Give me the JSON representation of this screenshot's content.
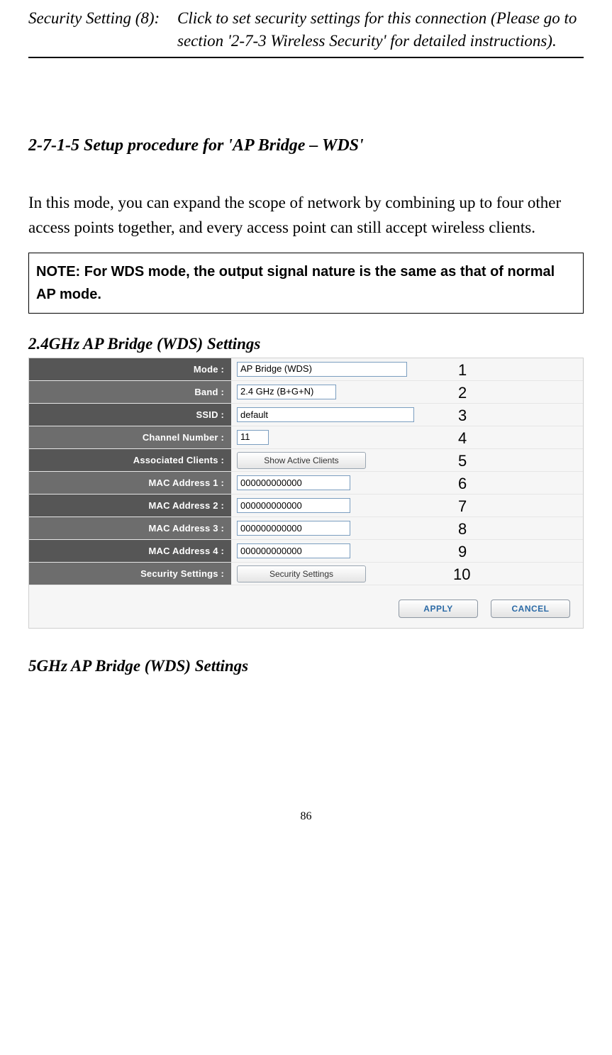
{
  "top": {
    "left": "Security Setting (8):",
    "right": "Click to set security settings for this connection (Please go to section '2-7-3 Wireless Security' for detailed instructions)."
  },
  "section_heading": "2-7-1-5 Setup procedure for 'AP Bridge – WDS'",
  "body_para": "In this mode, you can expand the scope of network by combining up to four other access points together, and every access point can still accept wireless clients.",
  "note_box": "NOTE: For WDS mode, the output signal nature is the same as that of normal AP mode.",
  "sub_heading_1": "2.4GHz AP Bridge (WDS) Settings",
  "sub_heading_2": "5GHz AP Bridge (WDS) Settings",
  "rows": {
    "mode": {
      "label": "Mode :",
      "value": "AP Bridge (WDS)"
    },
    "band": {
      "label": "Band :",
      "value": "2.4 GHz (B+G+N)"
    },
    "ssid": {
      "label": "SSID :",
      "value": "default"
    },
    "chan": {
      "label": "Channel Number :",
      "value": "11"
    },
    "assoc": {
      "label": "Associated Clients :",
      "button": "Show Active Clients"
    },
    "mac1": {
      "label": "MAC Address 1 :",
      "value": "000000000000"
    },
    "mac2": {
      "label": "MAC Address 2 :",
      "value": "000000000000"
    },
    "mac3": {
      "label": "MAC Address 3 :",
      "value": "000000000000"
    },
    "mac4": {
      "label": "MAC Address 4 :",
      "value": "000000000000"
    },
    "sec": {
      "label": "Security Settings :",
      "button": "Security Settings"
    }
  },
  "apply": "APPLY",
  "cancel": "CANCEL",
  "anno": [
    "1",
    "2",
    "3",
    "4",
    "5",
    "6",
    "7",
    "8",
    "9",
    "10"
  ],
  "page_number": "86"
}
